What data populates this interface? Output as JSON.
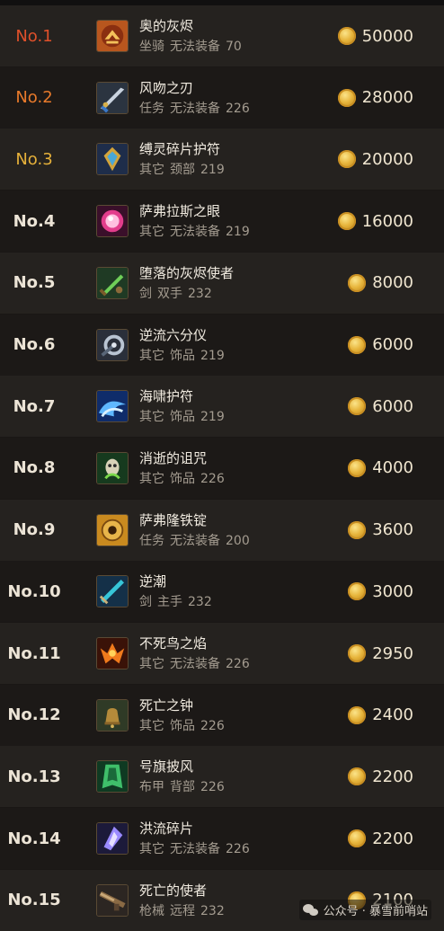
{
  "colors": {
    "rank1": "#e0502a",
    "rank2": "#e97a2b",
    "rank3": "#e6b13a",
    "rank_default": "#ece4d6"
  },
  "rows": [
    {
      "rank": "No.1",
      "name": "奥的灰烬",
      "type": "坐骑",
      "slot": "无法装备",
      "level": "70",
      "price": "50000",
      "icon": "ashes-icon"
    },
    {
      "rank": "No.2",
      "name": "风吻之刃",
      "type": "任务",
      "slot": "无法装备",
      "level": "226",
      "price": "28000",
      "icon": "blade-icon"
    },
    {
      "rank": "No.3",
      "name": "缚灵碎片护符",
      "type": "其它",
      "slot": "颈部",
      "level": "219",
      "price": "20000",
      "icon": "amulet-icon"
    },
    {
      "rank": "No.4",
      "name": "萨弗拉斯之眼",
      "type": "其它",
      "slot": "无法装备",
      "level": "219",
      "price": "16000",
      "icon": "eye-icon"
    },
    {
      "rank": "No.5",
      "name": "堕落的灰烬使者",
      "type": "剑",
      "slot": "双手",
      "level": "232",
      "price": "8000",
      "icon": "greatsword-icon"
    },
    {
      "rank": "No.6",
      "name": "逆流六分仪",
      "type": "其它",
      "slot": "饰品",
      "level": "219",
      "price": "6000",
      "icon": "sextant-icon"
    },
    {
      "rank": "No.7",
      "name": "海啸护符",
      "type": "其它",
      "slot": "饰品",
      "level": "219",
      "price": "6000",
      "icon": "tsunami-icon"
    },
    {
      "rank": "No.8",
      "name": "消逝的诅咒",
      "type": "其它",
      "slot": "饰品",
      "level": "226",
      "price": "4000",
      "icon": "curse-icon"
    },
    {
      "rank": "No.9",
      "name": "萨弗隆铁锭",
      "type": "任务",
      "slot": "无法装备",
      "level": "200",
      "price": "3600",
      "icon": "ingot-icon"
    },
    {
      "rank": "No.10",
      "name": "逆潮",
      "type": "剑",
      "slot": "主手",
      "level": "232",
      "price": "3000",
      "icon": "sword-icon"
    },
    {
      "rank": "No.11",
      "name": "不死鸟之焰",
      "type": "其它",
      "slot": "无法装备",
      "level": "226",
      "price": "2950",
      "icon": "phoenix-icon"
    },
    {
      "rank": "No.12",
      "name": "死亡之钟",
      "type": "其它",
      "slot": "饰品",
      "level": "226",
      "price": "2400",
      "icon": "bell-icon"
    },
    {
      "rank": "No.13",
      "name": "号旗披风",
      "type": "布甲",
      "slot": "背部",
      "level": "226",
      "price": "2200",
      "icon": "cloak-icon"
    },
    {
      "rank": "No.14",
      "name": "洪流碎片",
      "type": "其它",
      "slot": "无法装备",
      "level": "226",
      "price": "2200",
      "icon": "shard-icon"
    },
    {
      "rank": "No.15",
      "name": "死亡的使者",
      "type": "枪械",
      "slot": "远程",
      "level": "232",
      "price": "2100",
      "icon": "gun-icon"
    }
  ],
  "watermark": "公众号 · 暴雪前哨站"
}
